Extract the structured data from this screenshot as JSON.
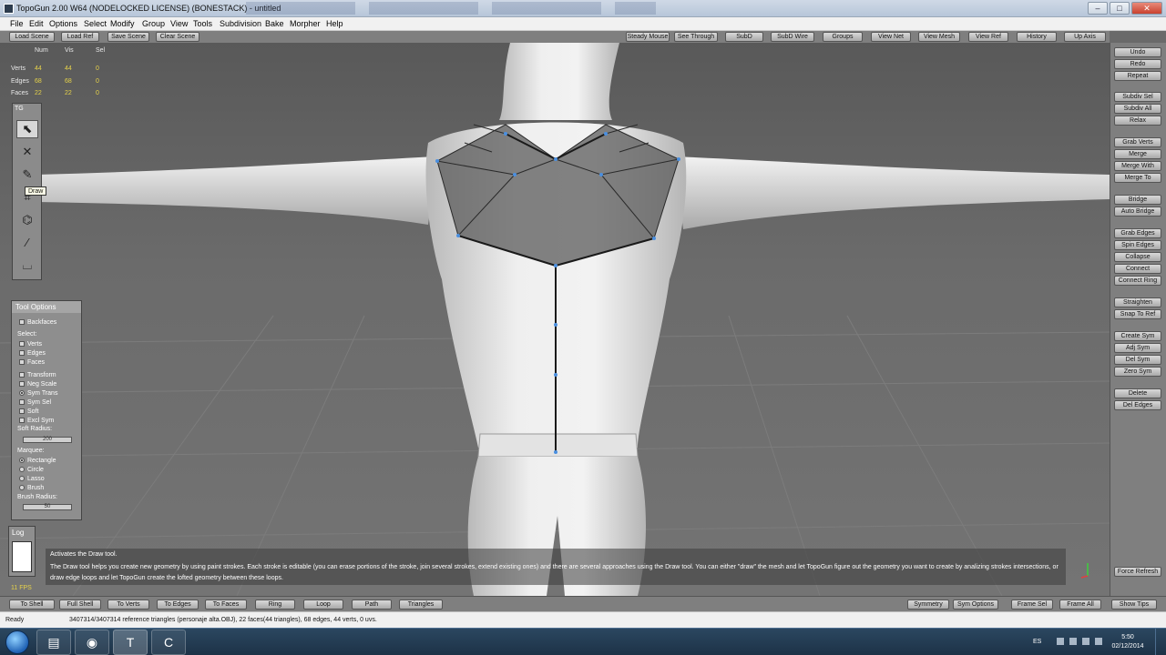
{
  "window": {
    "title": "TopoGun 2.00 W64  (NODELOCKED LICENSE) (BONESTACK) - untitled",
    "minimize": "–",
    "maximize": "□",
    "close": "✕"
  },
  "menu": [
    "File",
    "Edit",
    "Options",
    "Select",
    "Modify",
    "Group",
    "View",
    "Tools",
    "Subdivision",
    "Bake",
    "Morpher",
    "Help"
  ],
  "toolbar_left": [
    "Load Scene",
    "Load Ref",
    "Save Scene",
    "Clear Scene"
  ],
  "toolbar_right": [
    "Steady Mouse",
    "See Through",
    "SubD",
    "SubD Wire",
    "Groups",
    "View Net",
    "View Mesh",
    "View Ref",
    "History",
    "Up Axis"
  ],
  "stats": {
    "headers": [
      "Num",
      "Vis",
      "Sel"
    ],
    "rows": [
      {
        "label": "Verts",
        "num": "44",
        "vis": "44",
        "sel": "0"
      },
      {
        "label": "Edges",
        "num": "68",
        "vis": "68",
        "sel": "0"
      },
      {
        "label": "Faces",
        "num": "22",
        "vis": "22",
        "sel": "0"
      }
    ]
  },
  "palette": {
    "header": "TG",
    "tools": [
      {
        "icon": "select-arrow-icon",
        "glyph": "⬉",
        "active": true
      },
      {
        "icon": "x-cross-icon",
        "glyph": "✕",
        "active": false
      },
      {
        "icon": "draw-pencil-icon",
        "glyph": "✎",
        "active": false
      },
      {
        "icon": "extrude-icon",
        "glyph": "⌗",
        "active": false
      },
      {
        "icon": "bridge-icon",
        "glyph": "⌬",
        "active": false
      },
      {
        "icon": "brush-icon",
        "glyph": "∕",
        "active": false
      },
      {
        "icon": "rectangle-tool-icon",
        "glyph": "⌴",
        "active": false
      }
    ],
    "tooltip": "Draw"
  },
  "tool_options": {
    "title": "Tool Options",
    "backfaces": "Backfaces",
    "select_label": "Select:",
    "select": [
      "Verts",
      "Edges",
      "Faces"
    ],
    "flags": [
      {
        "label": "Transform",
        "type": "check",
        "on": false
      },
      {
        "label": "Neg Scale",
        "type": "check",
        "on": false
      },
      {
        "label": "Sym Trans",
        "type": "radio",
        "on": true
      },
      {
        "label": "Sym Sel",
        "type": "check",
        "on": false
      },
      {
        "label": "Soft",
        "type": "check",
        "on": false
      },
      {
        "label": "Excl Sym",
        "type": "check",
        "on": false
      }
    ],
    "soft_radius_label": "Soft Radius:",
    "soft_radius_value": "200",
    "marquee_label": "Marquee:",
    "marquee": [
      {
        "label": "Rectangle",
        "on": true
      },
      {
        "label": "Circle",
        "on": false
      },
      {
        "label": "Lasso",
        "on": false
      },
      {
        "label": "Brush",
        "on": false
      }
    ],
    "brush_radius_label": "Brush Radius:",
    "brush_radius_value": "50"
  },
  "log": {
    "title": "Log"
  },
  "help": {
    "title": "Activates the Draw tool.",
    "body": "The Draw tool helps you create new geometry by using paint strokes. Each stroke is editable (you can erase portions of the stroke, join several strokes, extend existing ones) and there are several approaches using the Draw tool. You can either \"draw\" the mesh and let TopoGun figure out the geometry you want to create by analizing strokes intersections, or draw edge loops and let TopoGun create the lofted geometry between these loops."
  },
  "fps": "11 FPS",
  "right_panel": [
    "Undo",
    "Redo",
    "Repeat",
    "Subdiv Sel",
    "Subdiv All",
    "Relax",
    "Grab Verts",
    "Merge",
    "Merge With",
    "Merge To",
    "Bridge",
    "Auto Bridge",
    "Grab Edges",
    "Spin Edges",
    "Collapse",
    "Connect",
    "Connect Ring",
    "Straighten",
    "Snap To Ref",
    "Create Sym",
    "Adj Sym",
    "Del Sym",
    "Zero Sym",
    "Delete",
    "Del Edges",
    "Force Refresh"
  ],
  "bottom_left": [
    "To Shell",
    "Full Shell",
    "To Verts",
    "To Edges",
    "To Faces",
    "Ring",
    "Loop",
    "Path",
    "Triangles"
  ],
  "bottom_right": [
    "Symmetry",
    "Sym Options",
    "Frame Sel",
    "Frame All",
    "Show Tips"
  ],
  "status": {
    "ready": "Ready",
    "info": "3407314/3407314 reference triangles (personaje alta.OBJ), 22 faces(44 triangles), 68 edges, 44 verts, 0 uvs."
  },
  "taskbar": {
    "apps": [
      {
        "icon": "folder-icon",
        "glyph": "▤"
      },
      {
        "icon": "chrome-icon",
        "glyph": "◉"
      },
      {
        "icon": "topogun-icon",
        "glyph": "T"
      },
      {
        "icon": "camtasia-icon",
        "glyph": "C"
      }
    ],
    "lang": "ES",
    "time": "5:50",
    "date": "02/12/2014"
  },
  "colors": {
    "accent_yellow": "#e6d24a",
    "mesh_blue": "#4a8fe0",
    "viewport_bg": "#6b6b6b"
  }
}
